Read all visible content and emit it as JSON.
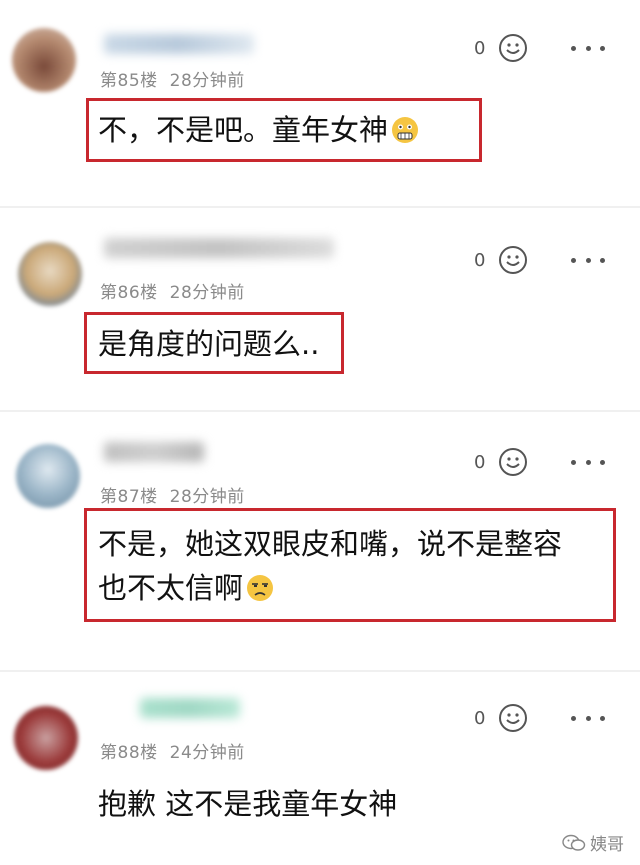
{
  "comments": [
    {
      "floor": "第85楼",
      "time": "28分钟前",
      "likes": "0",
      "text_lines": [
        "不，不是吧。童年女神"
      ],
      "emoji": "scared-face-emoji",
      "highlighted": true
    },
    {
      "floor": "第86楼",
      "time": "28分钟前",
      "likes": "0",
      "text_lines": [
        "是角度的问题么.."
      ],
      "emoji": "",
      "highlighted": true
    },
    {
      "floor": "第87楼",
      "time": "28分钟前",
      "likes": "0",
      "text_lines": [
        "不是，她这双眼皮和嘴，说不是整容",
        "也不太信啊"
      ],
      "emoji": "unamused-face-emoji",
      "highlighted": true
    },
    {
      "floor": "第88楼",
      "time": "24分钟前",
      "likes": "0",
      "text_lines": [
        "抱歉 这不是我童年女神"
      ],
      "emoji": "",
      "highlighted": false
    }
  ],
  "watermark": {
    "label": "姨哥",
    "icon": "wechat-icon"
  },
  "colors": {
    "highlight_border": "#c8282e",
    "meta_text": "#8a8a8a",
    "body_text": "#111111"
  }
}
